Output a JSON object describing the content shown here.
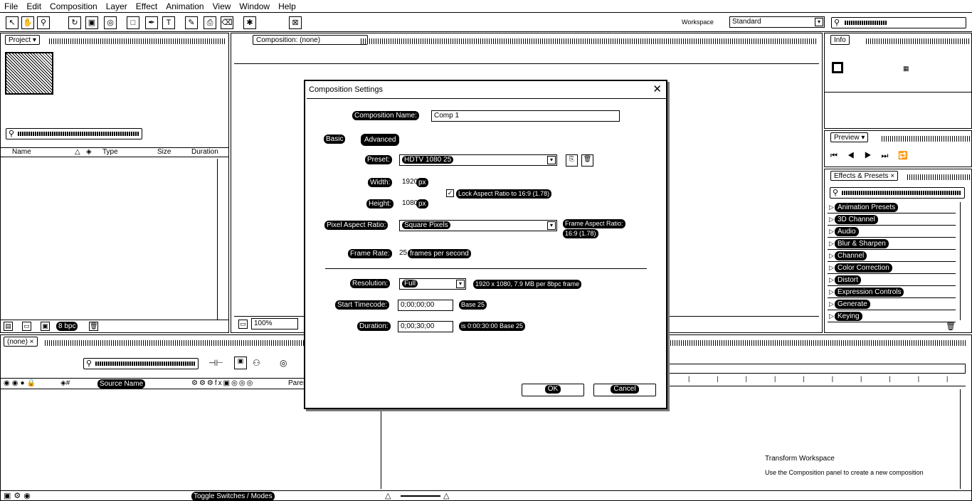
{
  "menu": [
    "File",
    "Edit",
    "Composition",
    "Layer",
    "Effect",
    "Animation",
    "View",
    "Window",
    "Help"
  ],
  "toolbar": {
    "workspace_label": "Workspace",
    "workspace_value": "Standard",
    "search_placeholder": "Search Help"
  },
  "project_panel": {
    "tab": "Project",
    "columns": [
      "Name",
      "Type",
      "Size",
      "Duration"
    ],
    "bpc": "8 bpc"
  },
  "comp_panel": {
    "tab": "Composition: (none)",
    "zoom": "100%"
  },
  "info_panel": {
    "tab": "Info"
  },
  "preview_panel": {
    "tab": "Preview"
  },
  "effects_panel": {
    "tab": "Effects & Presets",
    "items": [
      "Animation Presets",
      "3D Channel",
      "Audio",
      "Blur & Sharpen",
      "Channel",
      "Color Correction",
      "Distort",
      "Expression Controls",
      "Generate",
      "Keying"
    ]
  },
  "timeline": {
    "tab": "(none)",
    "source_name": "Source Name",
    "parent": "Parent",
    "toggle": "Toggle Switches / Modes",
    "hint_line1": "Transform Workspace",
    "hint_line2": "Use the Composition panel to create a new composition"
  },
  "dialog": {
    "title": "Composition Settings",
    "composition_name_label": "Composition Name:",
    "composition_name_value": "Comp 1",
    "tabs": {
      "basic": "Basic",
      "advanced": "Advanced"
    },
    "preset_label": "Preset:",
    "preset_value": "HDTV 1080 25",
    "width_label": "Width:",
    "width_value": "1920",
    "height_label": "Height:",
    "height_value": "1080",
    "px": "px",
    "lock_aspect": "Lock Aspect Ratio to 16:9 (1.78)",
    "pixel_aspect_label": "Pixel Aspect Ratio:",
    "pixel_aspect_value": "Square Pixels",
    "frame_aspect_label": "Frame Aspect Ratio:",
    "frame_aspect_value": "16:9 (1.78)",
    "frame_rate_label": "Frame Rate:",
    "frame_rate_value": "25",
    "frame_rate_unit": "frames per second",
    "resolution_label": "Resolution:",
    "resolution_value": "Full",
    "resolution_info": "1920 x 1080, 7.9 MB per 8bpc frame",
    "start_tc_label": "Start Timecode:",
    "start_tc_value": "0;00;00;00",
    "start_tc_base": "Base 25",
    "duration_label": "Duration:",
    "duration_value": "0;00;30;00",
    "duration_info": "is 0:00:30:00  Base 25",
    "ok": "OK",
    "cancel": "Cancel"
  }
}
